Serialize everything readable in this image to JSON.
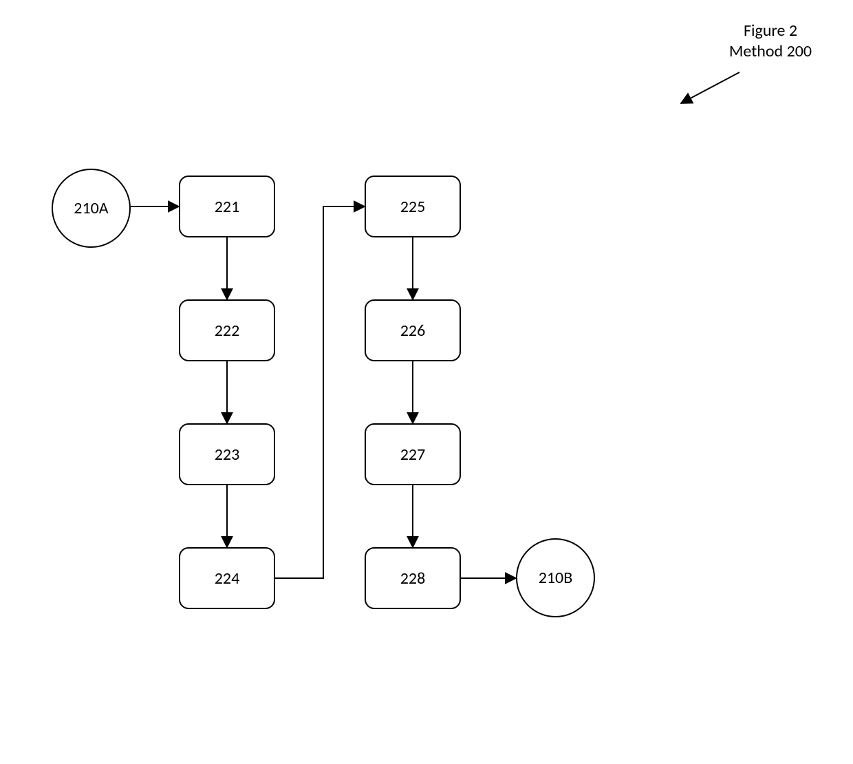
{
  "header": {
    "figure_label": "Figure 2",
    "method_label": "Method 200"
  },
  "nodes": {
    "start": "210A",
    "end": "210B",
    "b221": "221",
    "b222": "222",
    "b223": "223",
    "b224": "224",
    "b225": "225",
    "b226": "226",
    "b227": "227",
    "b228": "228"
  }
}
